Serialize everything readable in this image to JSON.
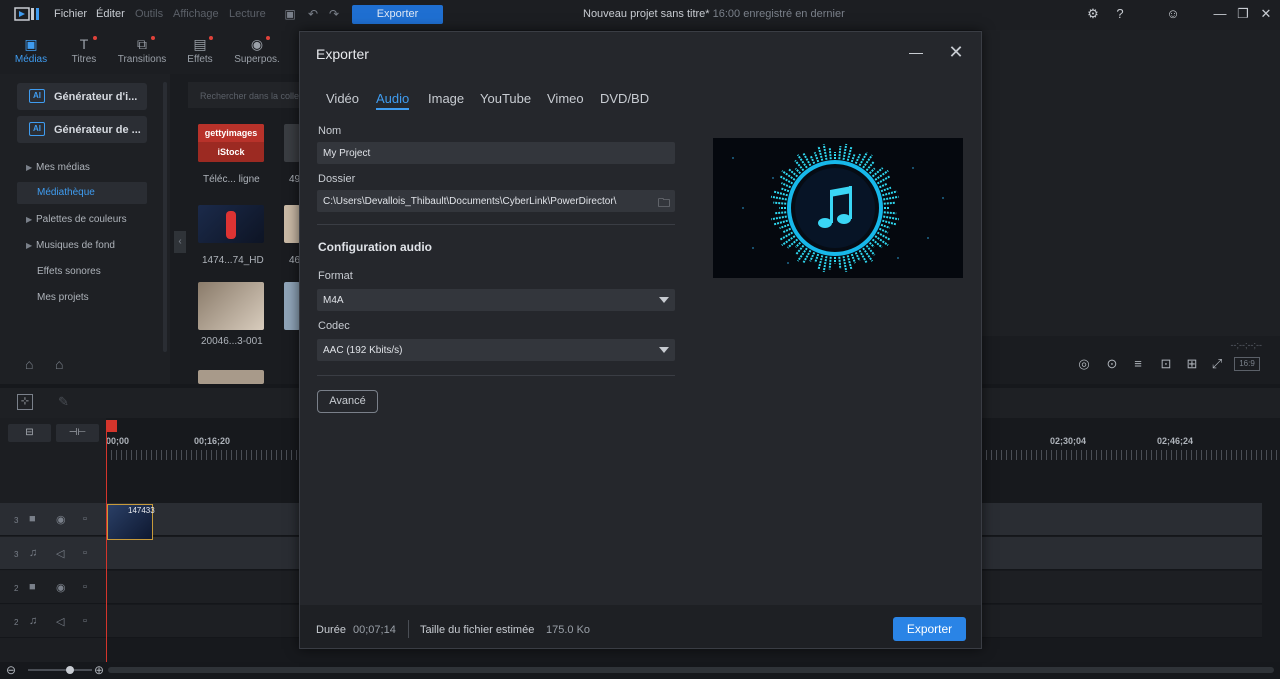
{
  "menubar": {
    "items": [
      "Fichier",
      "Éditer",
      "Outils",
      "Affichage",
      "Lecture"
    ],
    "export_label": "Exporter",
    "project_title": "Nouveau projet sans titre*",
    "saved_status": "16:00 enregistré en dernier"
  },
  "tooltabs": [
    {
      "label": "Médias",
      "icon": "media-icon"
    },
    {
      "label": "Titres",
      "icon": "title-icon"
    },
    {
      "label": "Transitions",
      "icon": "transition-icon"
    },
    {
      "label": "Effets",
      "icon": "effects-icon"
    },
    {
      "label": "Superpos.",
      "icon": "overlay-icon"
    }
  ],
  "sidebar": {
    "generators": [
      "Générateur d'i...",
      "Générateur de ..."
    ],
    "items": [
      {
        "label": "Mes médias",
        "chevron": true
      },
      {
        "label": "Médiathèque",
        "chevron": false
      },
      {
        "label": "Palettes de couleurs",
        "chevron": true
      },
      {
        "label": "Musiques de fond",
        "chevron": true
      },
      {
        "label": "Effets sonores",
        "chevron": false
      },
      {
        "label": "Mes projets",
        "chevron": false
      }
    ]
  },
  "media": {
    "search_placeholder": "Rechercher dans la collection",
    "thumb_labels": [
      "Téléc... ligne",
      "49",
      "1474...74_HD",
      "46",
      "20046...3-001"
    ],
    "getty_text": "gettyimages",
    "istock_text": "iStock"
  },
  "preview_pane": {
    "timecode": "--;--;--;--",
    "fit_label": "16:9"
  },
  "timeline": {
    "ruler_labels": [
      "00;00",
      "00;16;20",
      "02;30;04",
      "02;46;24"
    ],
    "clip_label": "147433",
    "tracks": [
      {
        "num": "3",
        "type": "video"
      },
      {
        "num": "3",
        "type": "audio"
      },
      {
        "num": "2",
        "type": "video"
      },
      {
        "num": "2",
        "type": "audio"
      }
    ]
  },
  "dialog": {
    "title": "Exporter",
    "tabs": [
      "Vidéo",
      "Audio",
      "Image",
      "YouTube",
      "Vimeo",
      "DVD/BD"
    ],
    "active_tab": "Audio",
    "name_label": "Nom",
    "name_value": "My Project",
    "folder_label": "Dossier",
    "folder_value": "C:\\Users\\Devallois_Thibault\\Documents\\CyberLink\\PowerDirector\\",
    "audio_config_title": "Configuration audio",
    "format_label": "Format",
    "format_value": "M4A",
    "codec_label": "Codec",
    "codec_value": "AAC (192 Kbits/s)",
    "advanced_label": "Avancé",
    "footer": {
      "duration_label": "Durée",
      "duration_value": "00;07;14",
      "size_label": "Taille du fichier estimée",
      "size_value": "175.0 Ko",
      "export_label": "Exporter"
    }
  },
  "colors": {
    "accent": "#3f9cf0",
    "export_button": "#2a84e6",
    "playhead": "#d4352c"
  }
}
